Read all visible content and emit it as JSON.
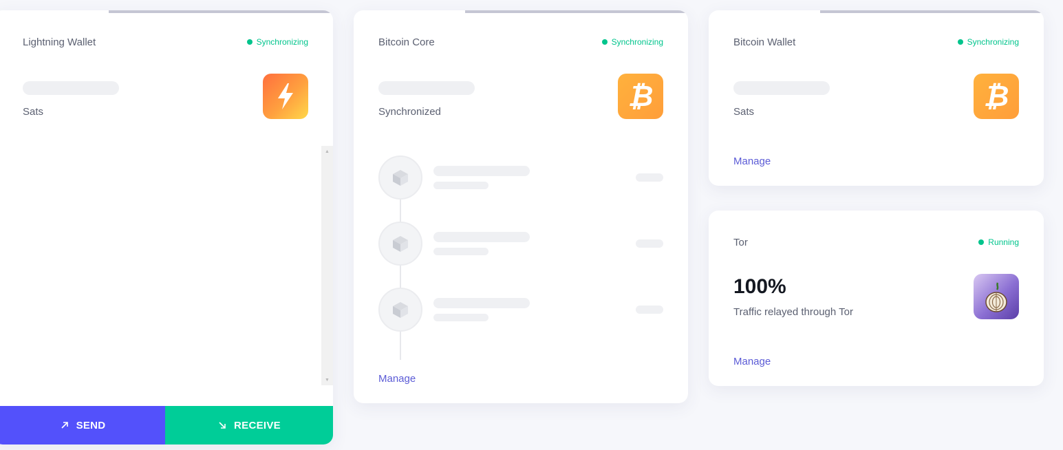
{
  "lightning_wallet": {
    "title": "Lightning Wallet",
    "status": "Synchronizing",
    "unit": "Sats",
    "icon": "lightning-bolt-icon",
    "send_label": "SEND",
    "receive_label": "RECEIVE",
    "progress": 0.67
  },
  "bitcoin_core": {
    "title": "Bitcoin Core",
    "status": "Synchronizing",
    "sync_label": "Synchronized",
    "icon": "bitcoin-icon",
    "manage_label": "Manage",
    "progress": 0.67
  },
  "bitcoin_wallet": {
    "title": "Bitcoin Wallet",
    "status": "Synchronizing",
    "unit": "Sats",
    "icon": "bitcoin-icon",
    "manage_label": "Manage",
    "progress": 0.67
  },
  "tor": {
    "title": "Tor",
    "status": "Running",
    "value": "100%",
    "description": "Traffic relayed through Tor",
    "icon": "tor-onion-icon",
    "manage_label": "Manage"
  },
  "colors": {
    "status_green": "#00c48c",
    "send_purple": "#5351fb",
    "receive_green": "#00cd98",
    "manage_link": "#5b5bd6"
  }
}
